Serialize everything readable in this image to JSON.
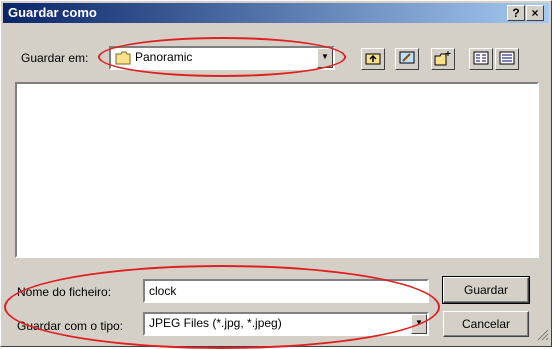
{
  "window": {
    "title": "Guardar como",
    "help_label": "?",
    "close_label": "×"
  },
  "location": {
    "label": "Guardar em:",
    "value": "Panoramic"
  },
  "toolbar": {
    "icons": [
      "up-folder-icon",
      "desktop-icon",
      "new-folder-icon",
      "list-view-icon",
      "details-view-icon"
    ]
  },
  "filename": {
    "label": "Nome do ficheiro:",
    "value": "clock"
  },
  "filetype": {
    "label": "Guardar com o tipo:",
    "value": "JPEG Files (*.jpg, *.jpeg)"
  },
  "buttons": {
    "save": "Guardar",
    "cancel": "Cancelar"
  },
  "annotation_color": "#e02020"
}
